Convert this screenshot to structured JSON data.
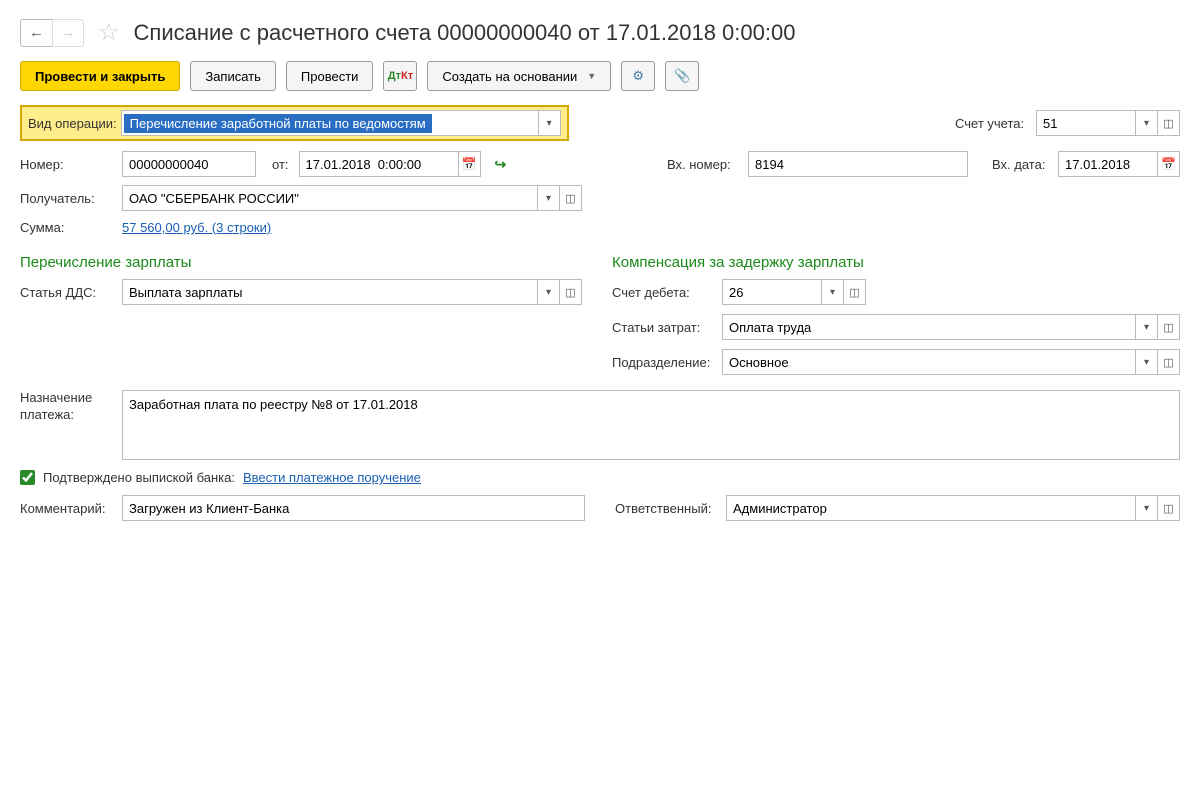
{
  "title": "Списание с расчетного счета 00000000040 от 17.01.2018 0:00:00",
  "toolbar": {
    "primary": "Провести и закрыть",
    "save": "Записать",
    "post": "Провести",
    "create_on_basis": "Создать на основании"
  },
  "operation": {
    "label": "Вид операции:",
    "value": "Перечисление заработной платы по ведомостям"
  },
  "account": {
    "label": "Счет учета:",
    "value": "51"
  },
  "number": {
    "label": "Номер:",
    "value": "00000000040"
  },
  "date": {
    "label": "от:",
    "value": "17.01.2018  0:00:00"
  },
  "in_number": {
    "label": "Вх. номер:",
    "value": "8194"
  },
  "in_date": {
    "label": "Вх. дата:",
    "value": "17.01.2018"
  },
  "recipient": {
    "label": "Получатель:",
    "value": "ОАО \"СБЕРБАНК РОССИИ\""
  },
  "sum": {
    "label": "Сумма:",
    "link": "57 560,00 руб. (3 строки)"
  },
  "section_left": "Перечисление зарплаты",
  "section_right": "Компенсация за задержку зарплаты",
  "dds": {
    "label": "Статья ДДС:",
    "value": "Выплата зарплаты"
  },
  "debit_account": {
    "label": "Счет дебета:",
    "value": "26"
  },
  "cost_items": {
    "label": "Статьи затрат:",
    "value": "Оплата труда"
  },
  "department": {
    "label": "Подразделение:",
    "value": "Основное"
  },
  "purpose": {
    "label": "Назначение платежа:",
    "value": "Заработная плата по реестру №8 от 17.01.2018"
  },
  "confirmed": {
    "label": "Подтверждено выпиской банка:",
    "link": "Ввести платежное поручение"
  },
  "comment": {
    "label": "Комментарий:",
    "value": "Загружен из Клиент-Банка"
  },
  "responsible": {
    "label": "Ответственный:",
    "value": "Администратор"
  }
}
